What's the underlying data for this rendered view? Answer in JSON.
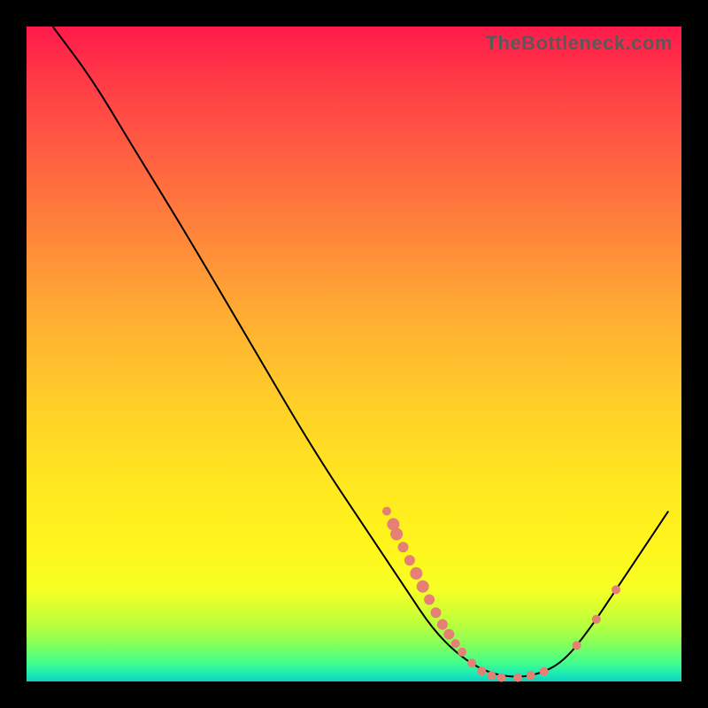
{
  "watermark": "TheBottleneck.com",
  "colors": {
    "dot": "#e58074",
    "curve": "#000000",
    "frame_bg_top": "#ff1a4b",
    "frame_bg_bottom": "#10d0c0",
    "page_bg": "#000000"
  },
  "chart_data": {
    "type": "line",
    "title": "",
    "xlabel": "",
    "ylabel": "",
    "xlim": [
      0,
      100
    ],
    "ylim": [
      0,
      100
    ],
    "curve": [
      {
        "x": 4,
        "y": 100
      },
      {
        "x": 10,
        "y": 92
      },
      {
        "x": 16,
        "y": 82
      },
      {
        "x": 24,
        "y": 69
      },
      {
        "x": 34,
        "y": 52
      },
      {
        "x": 44,
        "y": 35
      },
      {
        "x": 52,
        "y": 23
      },
      {
        "x": 58,
        "y": 14
      },
      {
        "x": 62,
        "y": 8
      },
      {
        "x": 66,
        "y": 4
      },
      {
        "x": 70,
        "y": 1.5
      },
      {
        "x": 74,
        "y": 0.6
      },
      {
        "x": 78,
        "y": 1
      },
      {
        "x": 82,
        "y": 3
      },
      {
        "x": 86,
        "y": 8
      },
      {
        "x": 90,
        "y": 14
      },
      {
        "x": 94,
        "y": 20
      },
      {
        "x": 98,
        "y": 26
      }
    ],
    "dots": [
      {
        "x": 55,
        "y": 26,
        "r": 5
      },
      {
        "x": 56,
        "y": 24,
        "r": 7
      },
      {
        "x": 56.5,
        "y": 22.5,
        "r": 7
      },
      {
        "x": 57.5,
        "y": 20.5,
        "r": 6
      },
      {
        "x": 58.5,
        "y": 18.5,
        "r": 6
      },
      {
        "x": 59.5,
        "y": 16.5,
        "r": 7
      },
      {
        "x": 60.5,
        "y": 14.5,
        "r": 7
      },
      {
        "x": 61.5,
        "y": 12.5,
        "r": 6
      },
      {
        "x": 62.5,
        "y": 10.5,
        "r": 6
      },
      {
        "x": 63.5,
        "y": 8.7,
        "r": 6
      },
      {
        "x": 64.5,
        "y": 7.2,
        "r": 6
      },
      {
        "x": 65.5,
        "y": 5.8,
        "r": 5
      },
      {
        "x": 66.5,
        "y": 4.5,
        "r": 5
      },
      {
        "x": 68.0,
        "y": 2.8,
        "r": 5
      },
      {
        "x": 69.5,
        "y": 1.6,
        "r": 5
      },
      {
        "x": 71.0,
        "y": 0.9,
        "r": 5
      },
      {
        "x": 72.5,
        "y": 0.6,
        "r": 5
      },
      {
        "x": 75.0,
        "y": 0.6,
        "r": 5
      },
      {
        "x": 77.0,
        "y": 0.9,
        "r": 5
      },
      {
        "x": 79.0,
        "y": 1.5,
        "r": 5
      },
      {
        "x": 84.0,
        "y": 5.5,
        "r": 5
      },
      {
        "x": 87.0,
        "y": 9.5,
        "r": 5
      },
      {
        "x": 90.0,
        "y": 14.0,
        "r": 5
      }
    ]
  }
}
